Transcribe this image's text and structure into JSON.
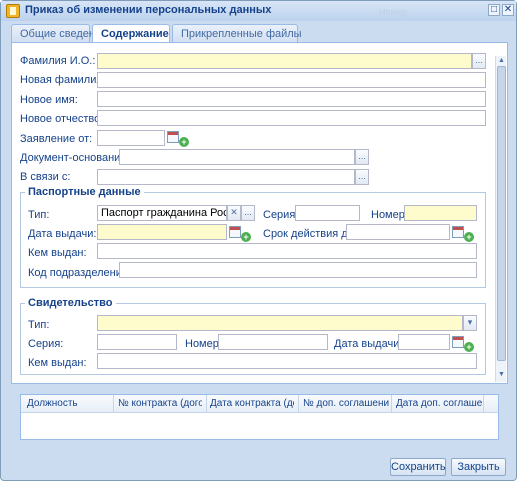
{
  "window": {
    "title": "Приказ об изменении персональных данных",
    "ghost_text": "Номер",
    "min_label": "□",
    "close_label": "✕"
  },
  "tabs": [
    {
      "label": "Общие сведения",
      "active": false
    },
    {
      "label": "Содержание",
      "active": true
    },
    {
      "label": "Прикрепленные файлы",
      "active": false
    }
  ],
  "form": {
    "fio_label": "Фамилия И.О.:",
    "fio_value": "",
    "new_lastname_label": "Новая фамилия:",
    "new_firstname_label": "Новое имя:",
    "new_patronymic_label": "Новое отчество:",
    "statement_label": "Заявление от:",
    "basis_doc_label": "Документ-основание:",
    "reason_label": "В связи с:",
    "picker_label": "..."
  },
  "passport": {
    "title": "Паспортные данные",
    "type_label": "Тип:",
    "type_value": "Паспорт гражданина Российской Федерации",
    "clear_label": "✕",
    "series_label": "Серия:",
    "number_label": "Номер:",
    "issue_date_label": "Дата выдачи:",
    "valid_until_label": "Срок действия до:",
    "issued_by_label": "Кем выдан:",
    "division_code_label": "Код подразделения:"
  },
  "certificate": {
    "title": "Свидетельство",
    "type_label": "Тип:",
    "series_label": "Серия:",
    "number_label": "Номер:",
    "issue_date_label": "Дата выдачи:",
    "issued_by_label": "Кем выдан:",
    "dropdown_glyph": "▾"
  },
  "grid": {
    "columns": [
      "Должность",
      "№ контракта (договора)",
      "Дата контракта (договора)",
      "№ доп. соглашения",
      "Дата доп. соглашения"
    ]
  },
  "buttons": {
    "save": "Сохранить",
    "close": "Закрыть"
  },
  "icons": {
    "app": "document-icon",
    "calendar": "calendar-icon",
    "add": "add-icon"
  },
  "colors": {
    "required_field": "#fefccd",
    "window_bg": "#cbdcf0",
    "accent": "#15428b"
  }
}
